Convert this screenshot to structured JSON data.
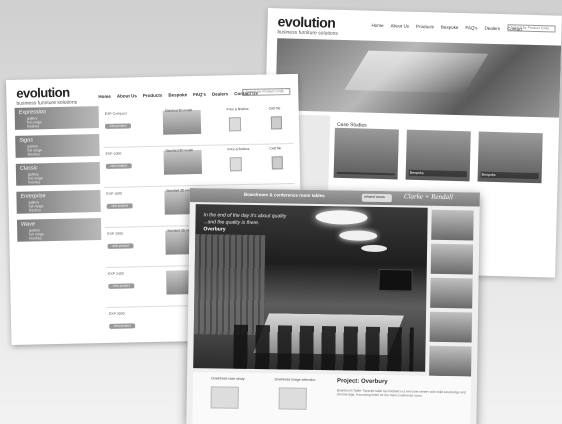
{
  "back": {
    "logo": "evolution",
    "tagline": "business furniture solutions",
    "nav": [
      "Home",
      "About Us",
      "Products",
      "Bespoke",
      "FAQ's",
      "Dealers",
      "Contact"
    ],
    "search_placeholder": "Search for Product Code",
    "section_title": "Case Studies",
    "thumbs": [
      {
        "caption": ""
      },
      {
        "caption": "Bespoke"
      },
      {
        "caption": "Bespoke"
      }
    ]
  },
  "left": {
    "logo": "evolution",
    "tagline": "business furniture solutions",
    "nav": [
      "Home",
      "About Us",
      "Products",
      "Bespoke",
      "FAQ's",
      "Dealers",
      "Contact Us"
    ],
    "search_placeholder": "Search for Product Code",
    "categories": [
      {
        "title": "Expression",
        "items": [
          "gallery",
          "full range",
          "finishes"
        ]
      },
      {
        "title": "Signs",
        "items": [
          "gallery",
          "full range",
          "finishes"
        ]
      },
      {
        "title": "Classic",
        "items": [
          "gallery",
          "full range",
          "finishes"
        ]
      },
      {
        "title": "Enterprise",
        "items": [
          "gallery",
          "full range",
          "finishes"
        ]
      },
      {
        "title": "Wave",
        "items": [
          "gallery",
          "full range",
          "finishes"
        ]
      }
    ],
    "rows": [
      {
        "name": "EXP Compact",
        "img": "Standard 3D model",
        "doc": "Price & finishes",
        "cad": "CAD file"
      },
      {
        "name": "EXP 1000",
        "img": "Standard 3D model",
        "doc": "Price & finishes",
        "cad": "CAD file"
      },
      {
        "name": "EXP 1600",
        "img": "Standard 3D model",
        "doc": "",
        "cad": ""
      },
      {
        "name": "EXP 2000",
        "img": "Standard 3D model",
        "doc": "",
        "cad": ""
      },
      {
        "name": "EXP 2400",
        "img": "",
        "doc": "",
        "cad": ""
      },
      {
        "name": "EXP 3000",
        "img": "",
        "doc": "",
        "cad": ""
      }
    ],
    "btn_label": "view product"
  },
  "front": {
    "crumb": "Boardroom & conference room tables",
    "dropdown": "related areas",
    "brand": "Clarke + Rendall",
    "quote_line1": "In the end of the day it's about quality",
    "quote_line2": "...and the quality is there.",
    "quote_name": "Overbury",
    "bottom_left": "Download case study",
    "bottom_mid": "Download image selection",
    "project_title": "Project: Overbury",
    "project_text": "Boardroom Table: Tapered table top finished in a two-tone veneer with solid wood edge and chrome legs. A stunning finish for the main conference room."
  }
}
